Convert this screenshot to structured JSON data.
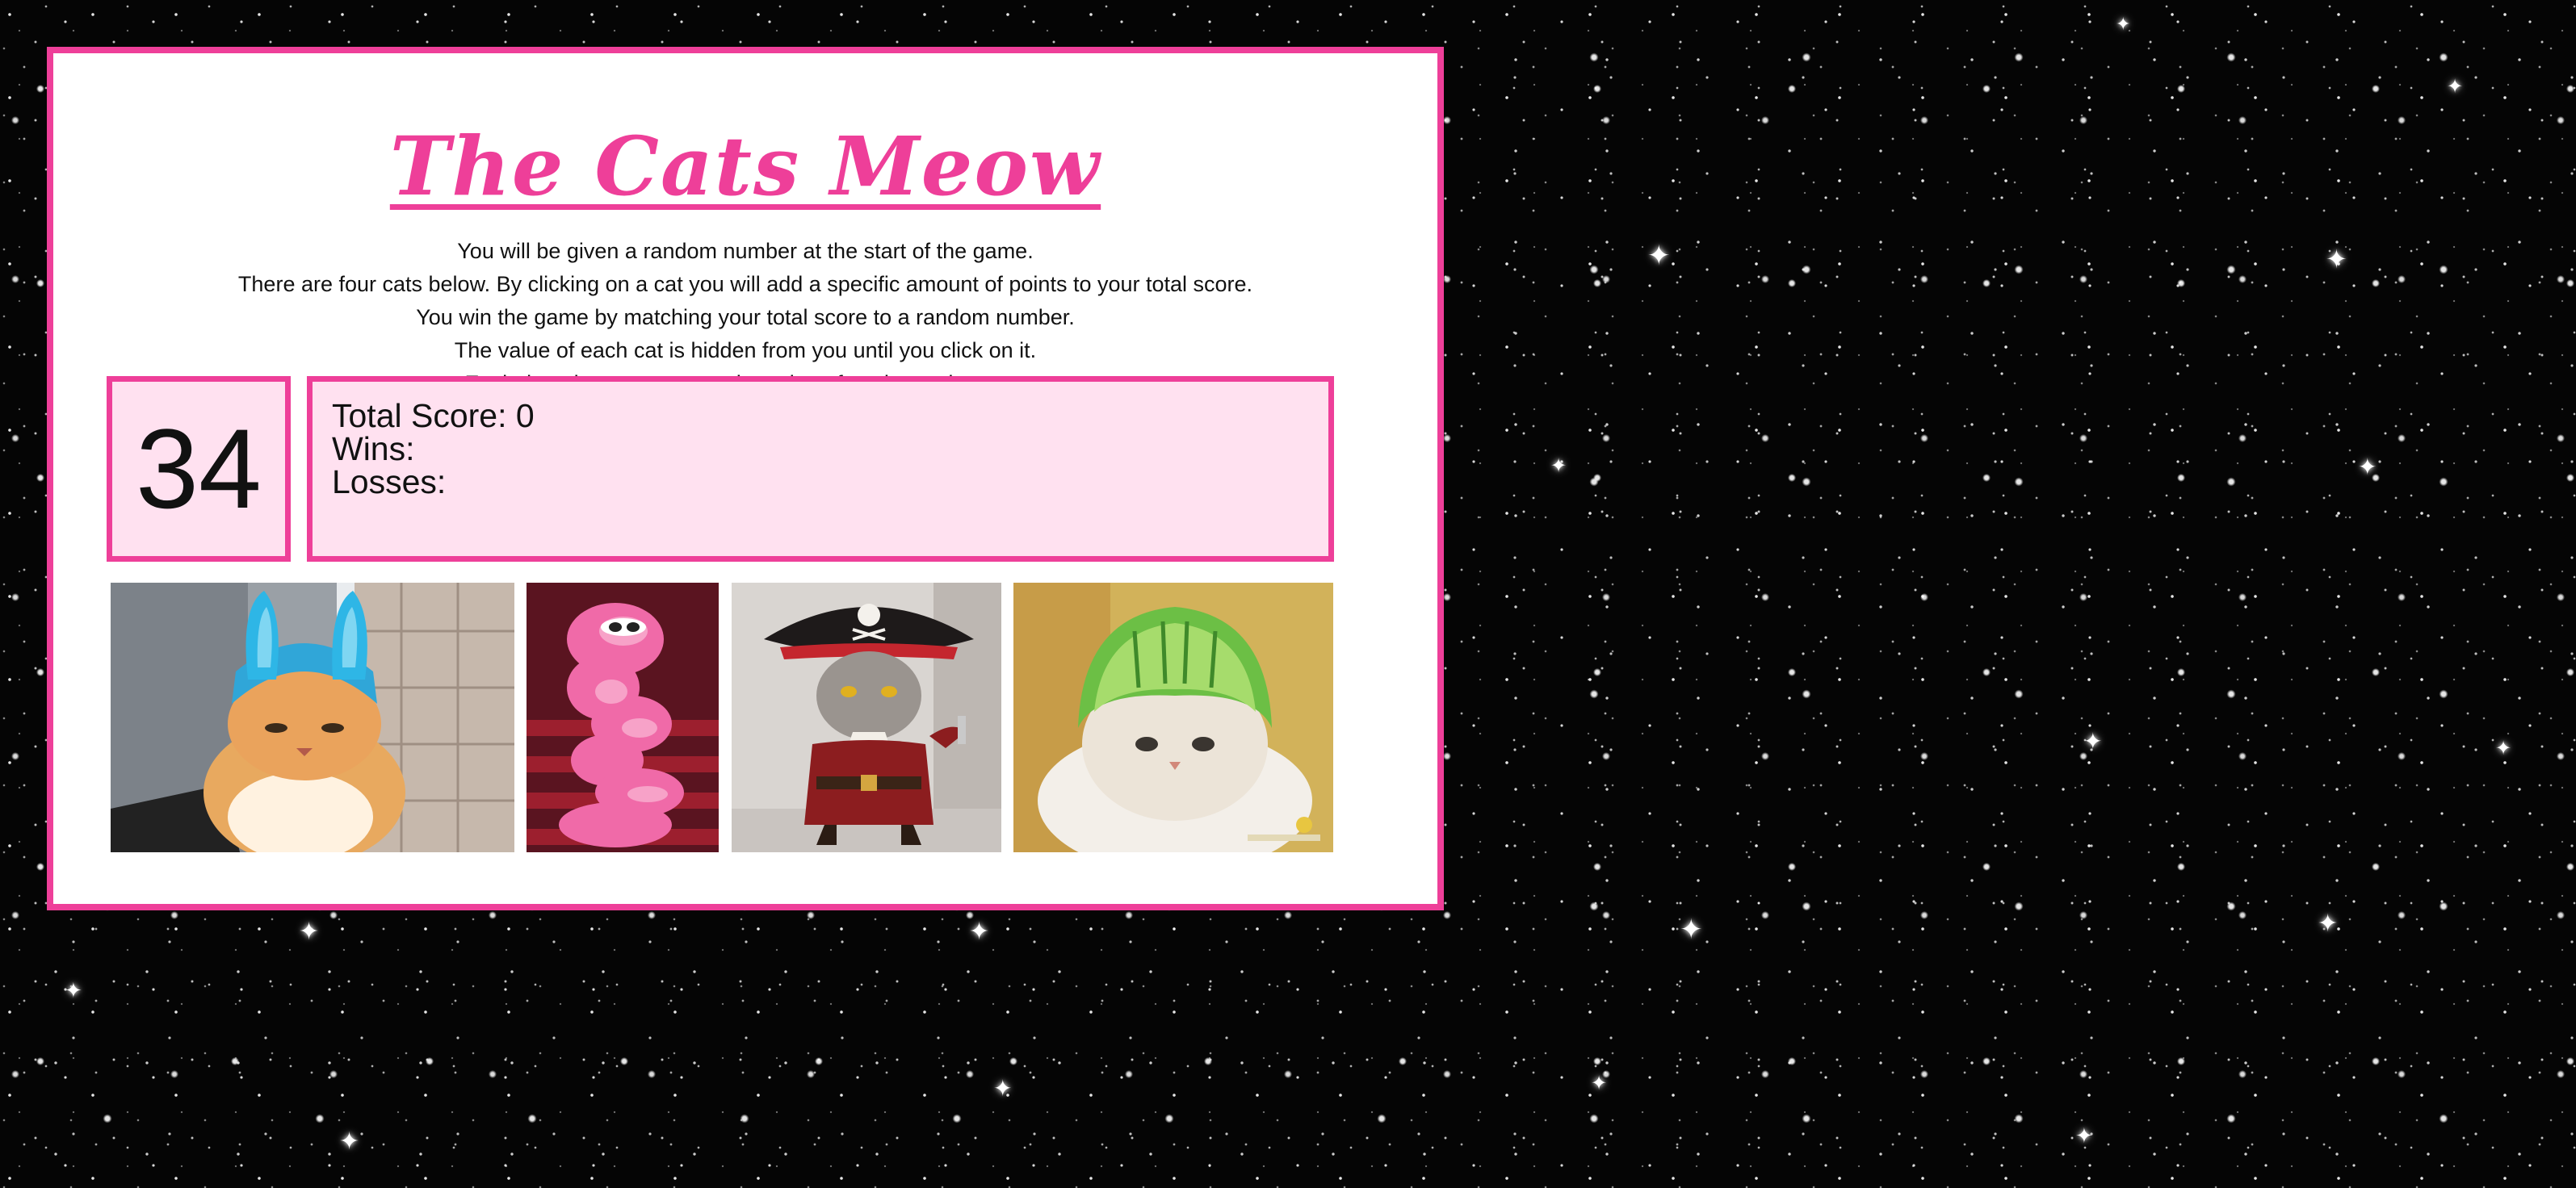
{
  "page": {
    "title": "The Cats Meow",
    "instructions": [
      "You will be given a random number at the start of the game.",
      "There are four cats below. By clicking on a cat you will add a specific amount of points to your total score.",
      "You win the game by matching your total score to a random number.",
      "The value of each cat is hidden from you until you click on it.",
      "Each time the game starts, the value of each cat changes."
    ]
  },
  "game": {
    "target_number": "34",
    "total_score_line": "Total Score: 0",
    "wins_line": "Wins: ",
    "losses_line": "Losses: "
  },
  "cats": [
    {
      "name": "cat-blue-bunny-hat",
      "icon": "bunny-ears-cat-image"
    },
    {
      "name": "cat-pink-feather-boa",
      "icon": "pink-boa-cat-image"
    },
    {
      "name": "cat-pirate-costume",
      "icon": "pirate-cat-image"
    },
    {
      "name": "cat-melon-helmet",
      "icon": "melon-helmet-cat-image"
    }
  ],
  "colors": {
    "accent_pink": "#ee3f99",
    "score_panel_fill": "#ffe1f0",
    "panel_background": "#ffffff",
    "page_background": "#050505"
  }
}
